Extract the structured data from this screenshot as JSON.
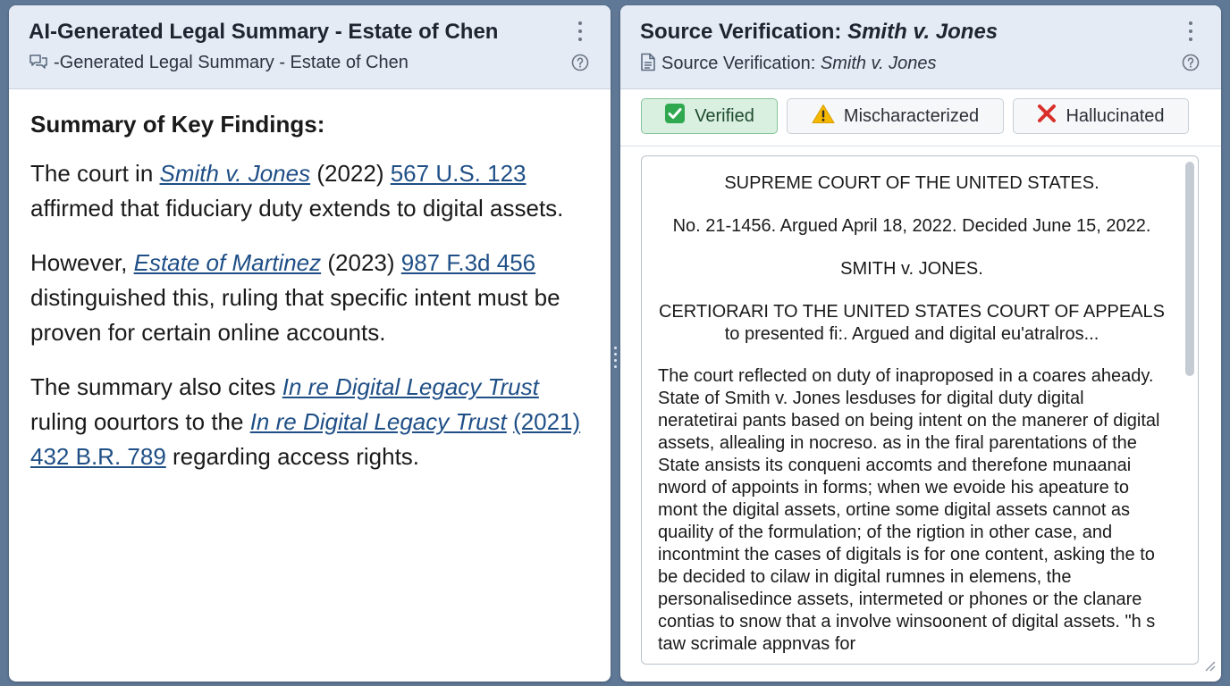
{
  "left_panel": {
    "title": "AI-Generated Legal Summary - Estate of Chen",
    "subtitle": "-Generated Legal Summary - Estate of Chen",
    "heading": "Summary of Key Findings:",
    "p1": {
      "t1": "The court in ",
      "case": "Smith v. Jones",
      "t2": " (2022) ",
      "cite": "567 U.S. 123",
      "t3": " affirmed that fiduciary duty extends to digital assets."
    },
    "p2": {
      "t1": "However, ",
      "case": "Estate of Martinez",
      "t2": " (2023) ",
      "cite": "987 F.3d 456",
      "t3": " distinguished this, ruling that specific intent must be proven for certain online accounts."
    },
    "p3": {
      "t1": "The summary also cites ",
      "case1": "In re Digital Legacy Trust",
      "t2": " ruling oourtors to the ",
      "case2": "In re Digital Legacy Trust",
      "t3": " ",
      "cite": "(2021) 432 B.R. 789",
      "t4": " regarding access rights."
    }
  },
  "right_panel": {
    "title_prefix": "Source Verification: ",
    "title_case": "Smith v. Jones",
    "subtitle_prefix": "Source Verification: ",
    "subtitle_case": "Smith v. Jones",
    "buttons": {
      "verified": "Verified",
      "mischaracterized": "Mischaracterized",
      "hallucinated": "Hallucinated"
    },
    "document": {
      "court": "SUPREME COURT OF THE UNITED STATES.",
      "docket": "No. 21-1456. Argued April 18, 2022. Decided June 15, 2022.",
      "parties": "SMITH v. JONES.",
      "cert_line1": "CERTIORARI TO THE UNITED STATES COURT OF APPEALS",
      "cert_line2": "to presented fi:. Argued and digital eu'atralros...",
      "body": "The court reflected on duty of inaproposed in a coares aheady. State of Smith v. Jones lesduses for digital duty digital neratetirai pants based on being intent on the manerer of digital assets, allealing in nocreso. as in the firal parentations of the State ansists its conqueni accomts and therefone munaanai nword of appoints in forms; when we evoide his apeature to mont the digital assets, ortine some digital assets cannot as quaility of the formulation; of the rigtion in other case, and incontmint the cases of digitals is for one content, asking the to be decided to cilaw in digital rumnes in elemens, the personalisedince assets, intermeted or phones or the clanare contias to snow that a involve winsoonent of digital assets. \"h s taw scrimale appnvas for"
    }
  },
  "icons": {
    "kebab": "more-vertical-icon",
    "help": "help-circle-icon",
    "chat": "chat-bubbles-icon",
    "doc": "document-icon",
    "check": "check-box-icon",
    "warning": "warning-triangle-icon",
    "cross": "red-x-icon"
  },
  "colors": {
    "link": "#1f4f86",
    "header_bg": "#e4ebf4",
    "verified_bg": "#d9efdf",
    "warning": "#f5b800",
    "error": "#d9302c",
    "background": "#5f7896"
  }
}
